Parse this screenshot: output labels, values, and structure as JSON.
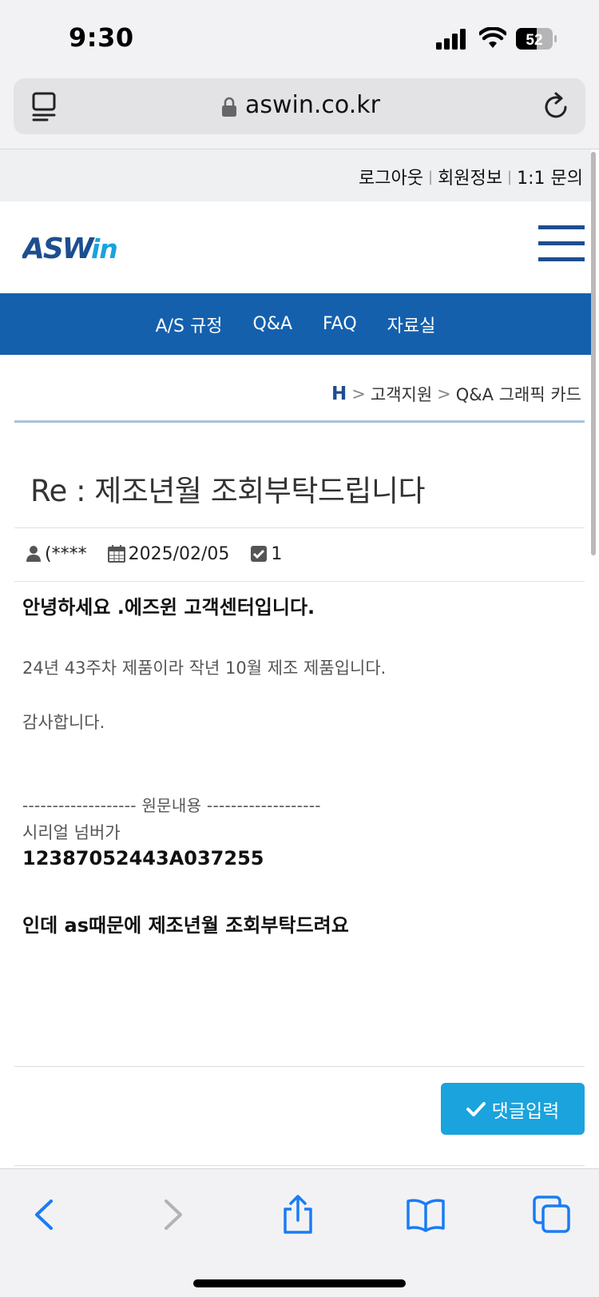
{
  "status_bar": {
    "time": "9:30",
    "battery": "52"
  },
  "browser": {
    "url": "aswin.co.kr"
  },
  "util_links": [
    "로그아웃",
    "회원정보",
    "1:1 문의"
  ],
  "nav": [
    "A/S 규정",
    "Q&A",
    "FAQ",
    "자료실"
  ],
  "breadcrumb": {
    "home": "H",
    "items": [
      "고객지원",
      "Q&A 그래픽 카드"
    ]
  },
  "post": {
    "title": "Re : 제조년월 조회부탁드립니다",
    "author": "(****",
    "date": "2025/02/05",
    "count": "1",
    "lines": {
      "greeting": "안녕하세요 .에즈윈 고객센터입니다.",
      "answer": "24년 43주차 제품이라 작년 10월 제조 제품입니다.",
      "thanks": "감사합니다.",
      "divider": "------------------- 원문내용 -------------------",
      "serial_label": "시리얼 넘버가",
      "serial": "12387052443A037255",
      "request": "인데 as때문에 제조년월 조회부탁드려요"
    }
  },
  "comment_button": "댓글입력",
  "colors": {
    "nav_bg": "#1460ad",
    "button_bg": "#1aa3dc",
    "logo": "#1d4e8f",
    "browser_blue": "#1a7cf5"
  }
}
